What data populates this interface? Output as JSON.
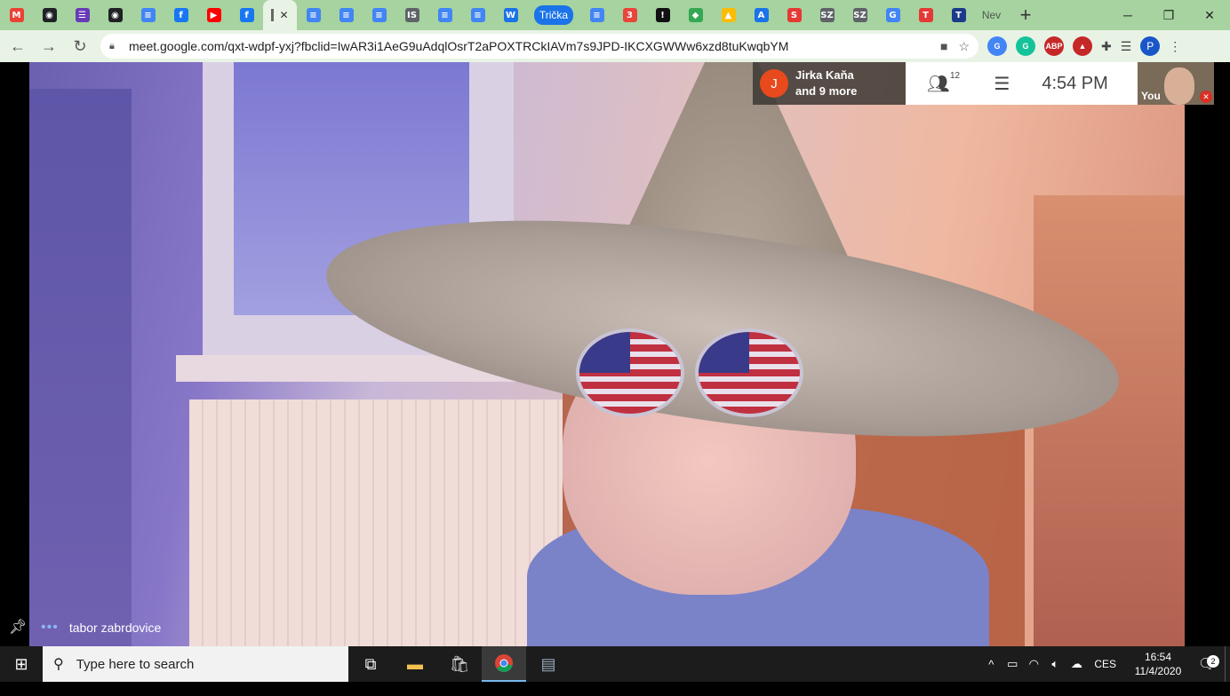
{
  "browser": {
    "tabs": [
      {
        "icon": "gmail-icon",
        "color": "#ea4335",
        "glyph": "M"
      },
      {
        "icon": "globe-icon",
        "color": "#202124",
        "glyph": "◉"
      },
      {
        "icon": "forms-icon",
        "color": "#673ab7",
        "glyph": "☰"
      },
      {
        "icon": "globe-icon",
        "color": "#202124",
        "glyph": "◉"
      },
      {
        "icon": "docs-icon",
        "color": "#4285f4",
        "glyph": "≡"
      },
      {
        "icon": "facebook-icon",
        "color": "#1877f2",
        "glyph": "f"
      },
      {
        "icon": "youtube-icon",
        "color": "#ff0000",
        "glyph": "▶"
      },
      {
        "icon": "facebook-icon",
        "color": "#1877f2",
        "glyph": "f"
      }
    ],
    "tabs_after": [
      {
        "icon": "docs-icon",
        "color": "#4285f4",
        "glyph": "≡"
      },
      {
        "icon": "docs-icon",
        "color": "#4285f4",
        "glyph": "≡"
      },
      {
        "icon": "docs-icon",
        "color": "#4285f4",
        "glyph": "≡"
      },
      {
        "icon": "is-icon",
        "color": "#5f6368",
        "glyph": "IS"
      },
      {
        "icon": "docs-icon",
        "color": "#4285f4",
        "glyph": "≡"
      },
      {
        "icon": "docs-icon",
        "color": "#4285f4",
        "glyph": "≡"
      },
      {
        "icon": "word-icon",
        "color": "#1a73e8",
        "glyph": "W"
      }
    ],
    "pill_tab": "Trička",
    "tabs_end": [
      {
        "icon": "docs-icon",
        "color": "#4285f4",
        "glyph": "≡"
      },
      {
        "icon": "calendar-icon",
        "color": "#e8453c",
        "glyph": "3"
      },
      {
        "icon": "exclamation-icon",
        "color": "#111111",
        "glyph": "!"
      },
      {
        "icon": "puzzle-icon",
        "color": "#34a853",
        "glyph": "◆"
      },
      {
        "icon": "drive-icon",
        "color": "#fbbc04",
        "glyph": "▲"
      },
      {
        "icon": "a-icon",
        "color": "#1a73e8",
        "glyph": "A"
      },
      {
        "icon": "s-icon",
        "color": "#e53935",
        "glyph": "S"
      },
      {
        "icon": "sz-icon",
        "color": "#5f6368",
        "glyph": "SZ"
      },
      {
        "icon": "sz-icon",
        "color": "#5f6368",
        "glyph": "SZ"
      },
      {
        "icon": "google-icon",
        "color": "#4285f4",
        "glyph": "G"
      },
      {
        "icon": "t-icon",
        "color": "#e53935",
        "glyph": "T"
      },
      {
        "icon": "t-icon",
        "color": "#1a3a8a",
        "glyph": "T"
      }
    ],
    "last_tab_label": "Nev",
    "url": "meet.google.com/qxt-wdpf-yxj?fbclid=IwAR3i1AeG9uAdqlOsrT2aPOXTRCkIAVm7s9JPD-IKCXGWWw6xzd8tuKwqbYM",
    "profile_letter": "P",
    "extensions": [
      {
        "name": "translate-extension-icon",
        "color": "#4285f4",
        "glyph": "G"
      },
      {
        "name": "grammarly-extension-icon",
        "color": "#15c39a",
        "glyph": "G"
      },
      {
        "name": "adblock-extension-icon",
        "color": "#c62828",
        "glyph": "ABP"
      },
      {
        "name": "redshield-extension-icon",
        "color": "#c62828",
        "glyph": "▲"
      }
    ]
  },
  "meet": {
    "others_initial": "J",
    "others_line1": "Jirka Kaňa",
    "others_line2": "and 9 more",
    "participant_count": "12",
    "time": "4:54 PM",
    "self_label": "You",
    "meeting_name": "tabor zabrdovice"
  },
  "taskbar": {
    "search_placeholder": "Type here to search",
    "language": "CES",
    "clock_time": "16:54",
    "clock_date": "11/4/2020",
    "notification_count": "2"
  }
}
